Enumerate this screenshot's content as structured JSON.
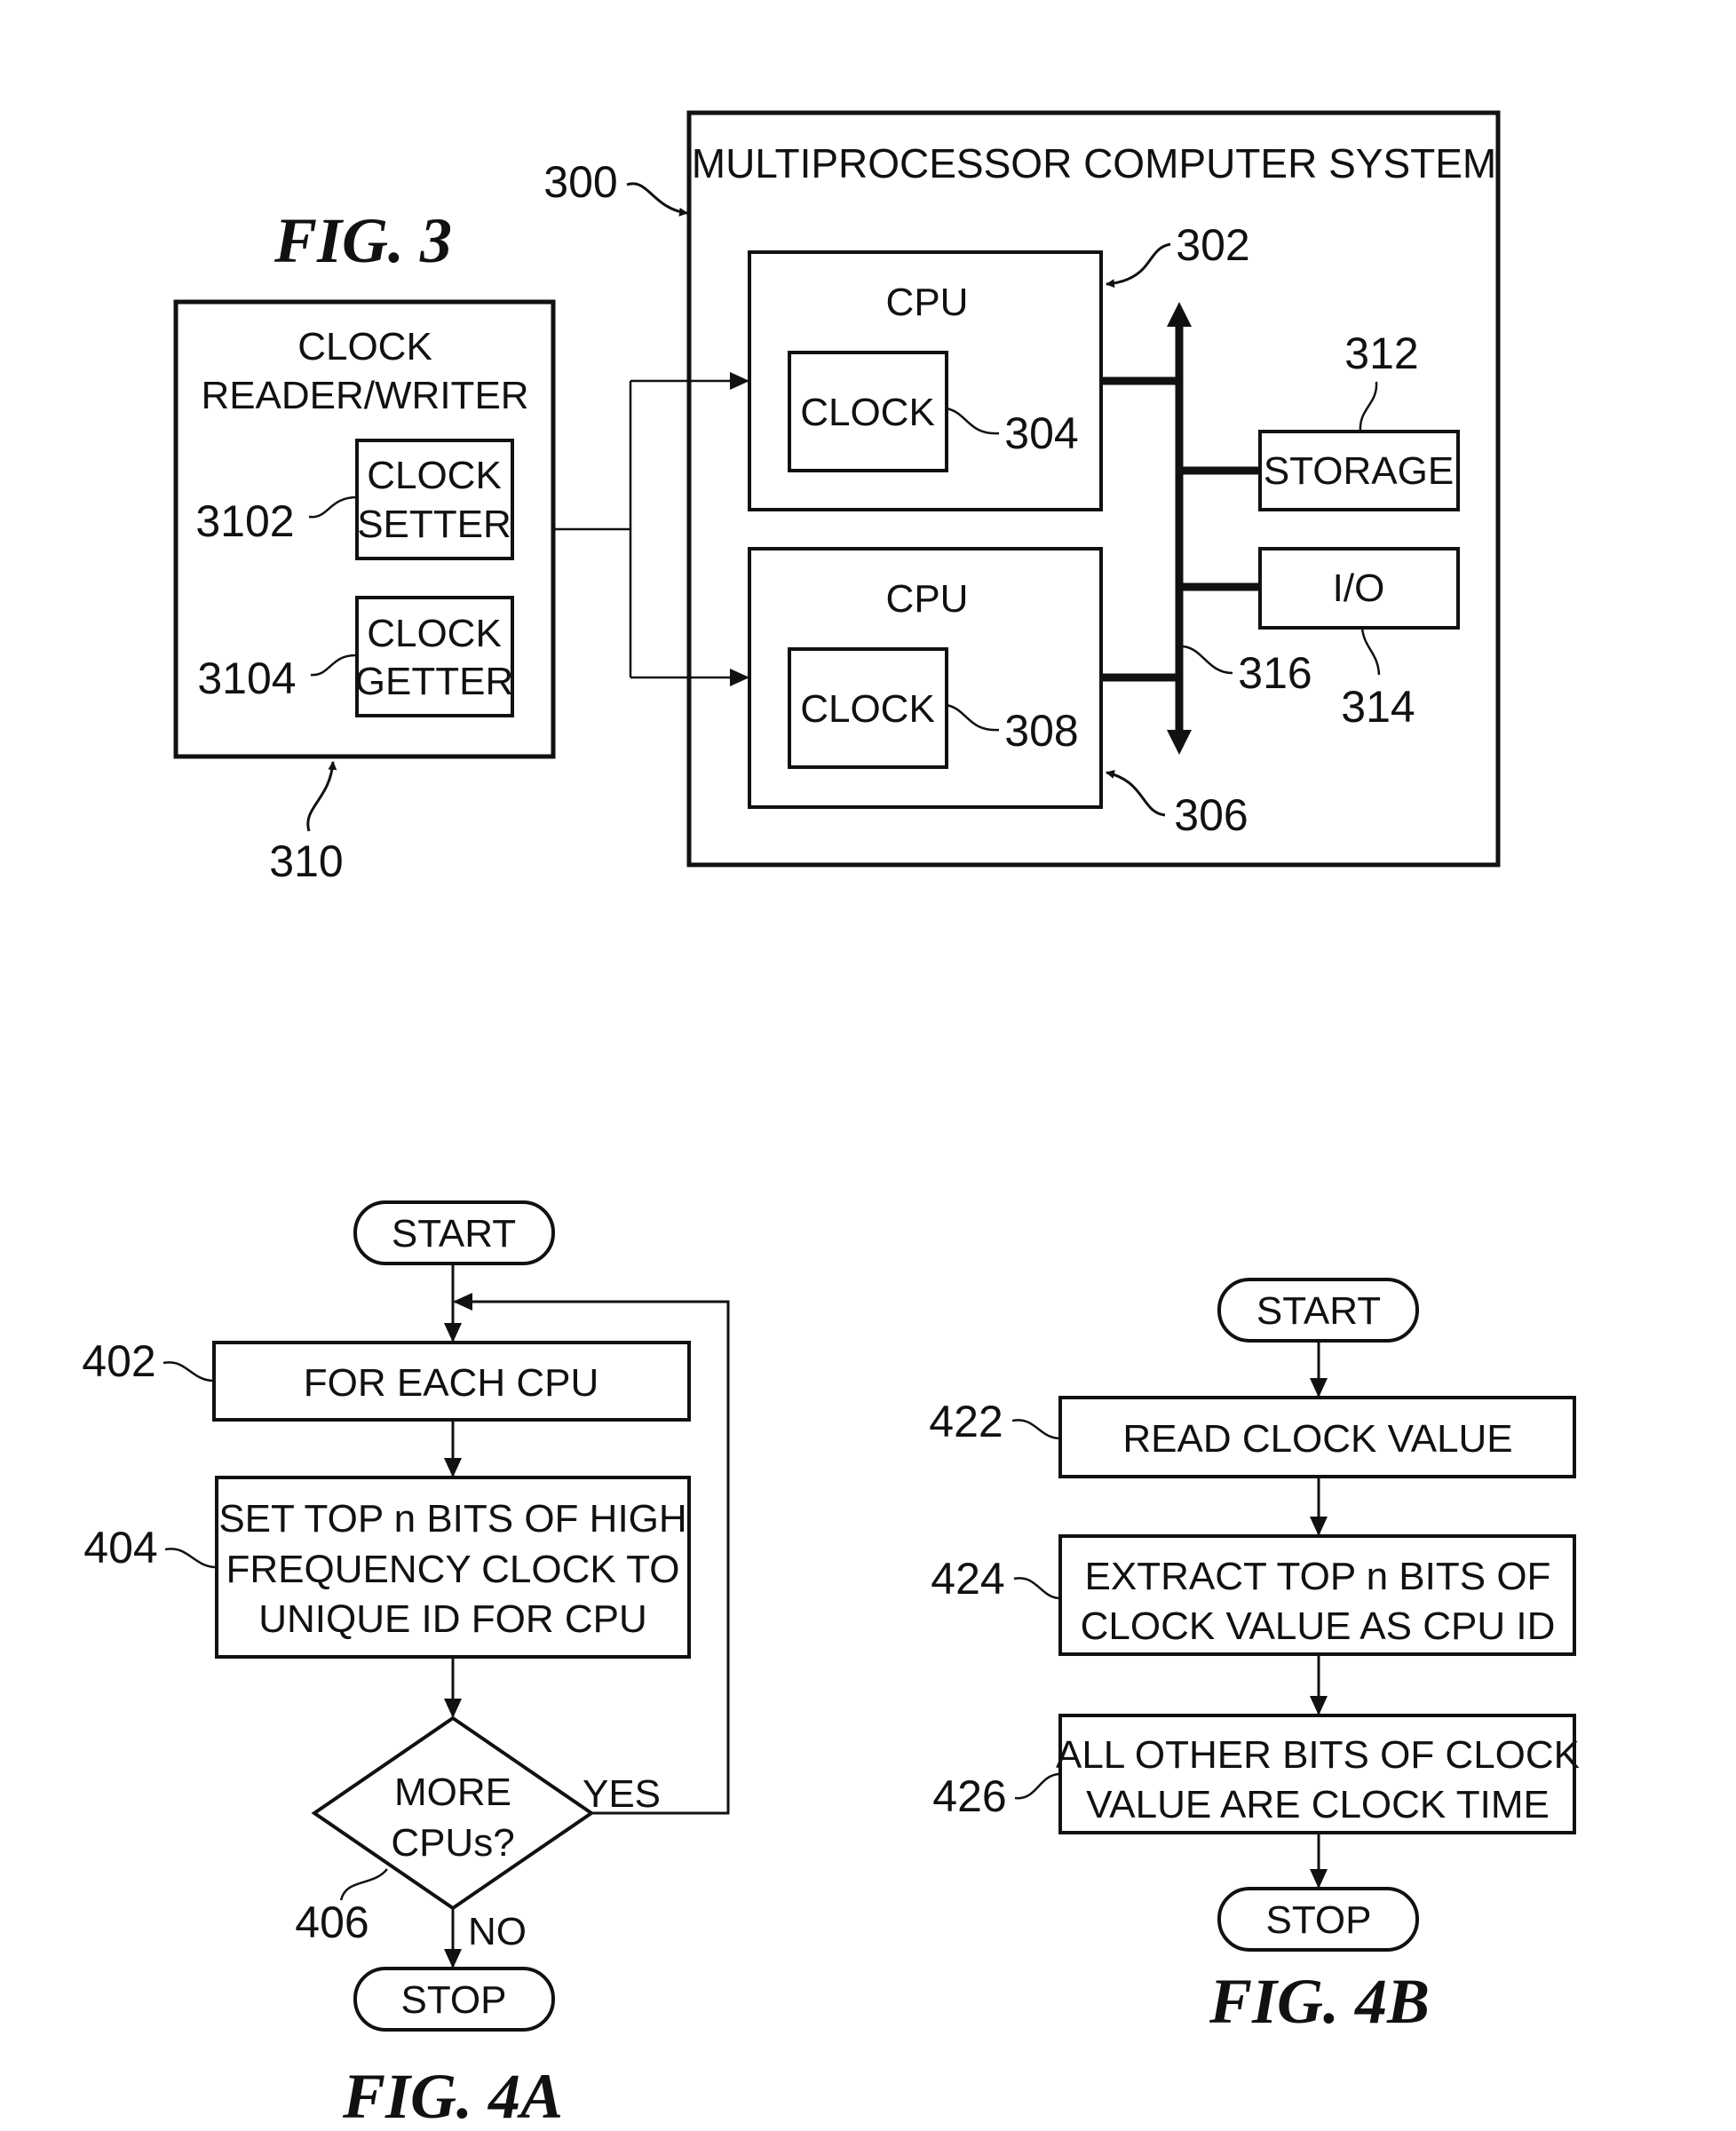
{
  "fig3": {
    "caption": "FIG. 3",
    "system": {
      "ref": "300",
      "title": "MULTIPROCESSOR COMPUTER SYSTEM"
    },
    "cpu1": {
      "ref": "302",
      "label": "CPU",
      "clock_label": "CLOCK",
      "clock_ref": "304"
    },
    "cpu2": {
      "ref": "306",
      "label": "CPU",
      "clock_label": "CLOCK",
      "clock_ref": "308"
    },
    "bus": {
      "ref": "316"
    },
    "storage": {
      "ref": "312",
      "label": "STORAGE"
    },
    "io": {
      "ref": "314",
      "label": "I/O"
    },
    "reader_writer": {
      "ref": "310",
      "title_line1": "CLOCK",
      "title_line2": "READER/WRITER",
      "setter": {
        "ref": "3102",
        "line1": "CLOCK",
        "line2": "SETTER"
      },
      "getter": {
        "ref": "3104",
        "line1": "CLOCK",
        "line2": "GETTER"
      }
    }
  },
  "fig4a": {
    "caption": "FIG. 4A",
    "start": "START",
    "stop": "STOP",
    "step402": {
      "ref": "402",
      "text": "FOR EACH CPU"
    },
    "step404": {
      "ref": "404",
      "line1": "SET TOP n BITS OF HIGH",
      "line2": "FREQUENCY CLOCK TO",
      "line3": "UNIQUE ID FOR CPU"
    },
    "decision406": {
      "ref": "406",
      "line1": "MORE",
      "line2": "CPUs?",
      "yes": "YES",
      "no": "NO"
    }
  },
  "fig4b": {
    "caption": "FIG. 4B",
    "start": "START",
    "stop": "STOP",
    "step422": {
      "ref": "422",
      "text": "READ CLOCK VALUE"
    },
    "step424": {
      "ref": "424",
      "line1": "EXTRACT TOP n BITS OF",
      "line2": "CLOCK VALUE AS CPU ID"
    },
    "step426": {
      "ref": "426",
      "line1": "ALL OTHER BITS OF CLOCK",
      "line2": "VALUE ARE CLOCK TIME"
    }
  }
}
